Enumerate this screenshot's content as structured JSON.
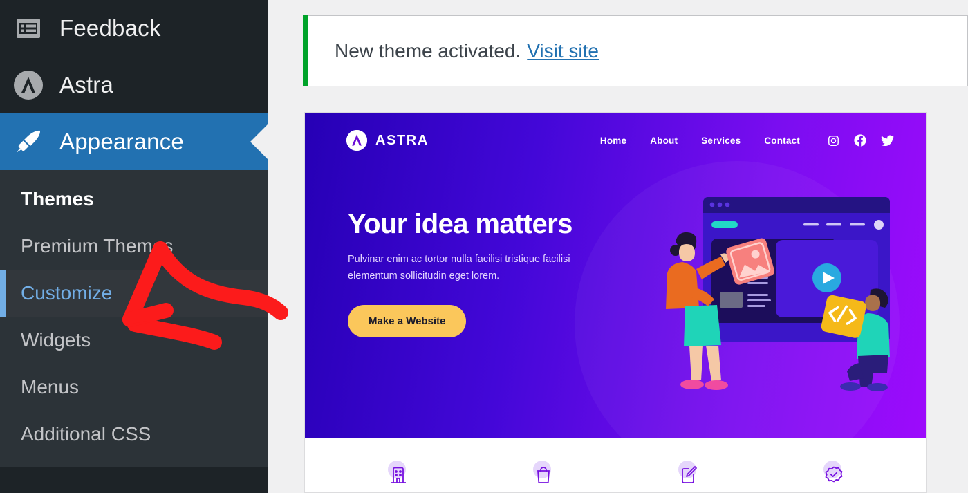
{
  "sidebar": {
    "menu": [
      {
        "label": "Feedback",
        "icon": "feedback-form-icon",
        "state": "normal"
      },
      {
        "label": "Astra",
        "icon": "astra-logo-icon",
        "state": "normal"
      },
      {
        "label": "Appearance",
        "icon": "paintbrush-icon",
        "state": "current"
      }
    ],
    "submenu": [
      {
        "label": "Themes",
        "state": "heading-current"
      },
      {
        "label": "Premium Themes",
        "state": "normal"
      },
      {
        "label": "Customize",
        "state": "current"
      },
      {
        "label": "Widgets",
        "state": "normal"
      },
      {
        "label": "Menus",
        "state": "normal"
      },
      {
        "label": "Additional CSS",
        "state": "normal"
      }
    ],
    "colors": {
      "background": "#1d2327",
      "submenu_background": "#2c3338",
      "current_highlight": "#2271b1",
      "current_link": "#72aee6"
    }
  },
  "notice": {
    "message": "New theme activated.",
    "link_label": "Visit site",
    "accent_color": "#00a32a"
  },
  "preview": {
    "header": {
      "brand": "ASTRA",
      "nav": [
        {
          "label": "Home"
        },
        {
          "label": "About"
        },
        {
          "label": "Services"
        },
        {
          "label": "Contact"
        }
      ],
      "social": [
        {
          "name": "instagram-icon"
        },
        {
          "name": "facebook-icon"
        },
        {
          "name": "twitter-icon"
        }
      ]
    },
    "hero": {
      "title": "Your idea matters",
      "subtitle": "Pulvinar enim ac tortor nulla facilisi tristique facilisi elementum sollicitudin eget lorem.",
      "cta_label": "Make a Website",
      "cta_color": "#fbc75b",
      "gradient_start": "#2600b5",
      "gradient_end": "#9d0bfc"
    },
    "features": [
      {
        "icon": "building-icon"
      },
      {
        "icon": "shopping-bag-icon"
      },
      {
        "icon": "edit-document-icon"
      },
      {
        "icon": "verified-check-icon"
      }
    ]
  },
  "annotation": {
    "type": "red-arrow",
    "color": "#fc1b1b",
    "points_at": "Customize"
  }
}
